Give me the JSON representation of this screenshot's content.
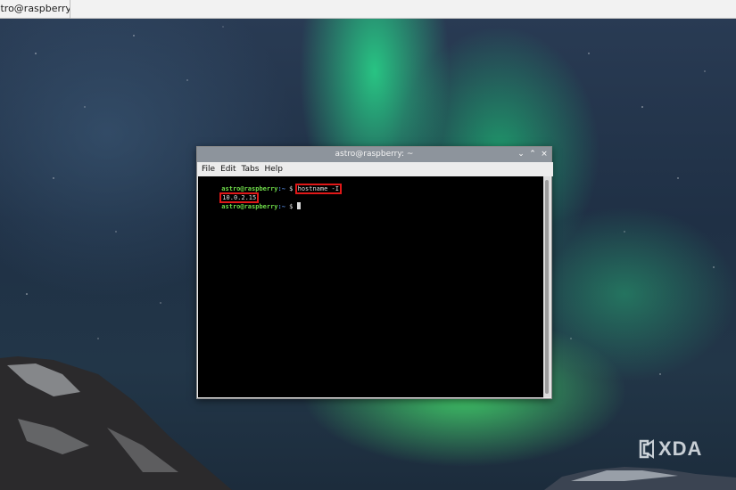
{
  "window": {
    "title": "astro@raspberry: ~"
  },
  "terminal": {
    "title": "astro@raspberry: ~",
    "menu": [
      "File",
      "Edit",
      "Tabs",
      "Help"
    ],
    "prompt_user": "astro@raspberry",
    "prompt_path": ":~",
    "prompt_symbol": " $ ",
    "command": "hostname -I",
    "output": "10.0.2.15",
    "controls": {
      "minimize": "⌄",
      "maximize": "⌃",
      "close": "×"
    }
  },
  "watermark": {
    "text": "XDA"
  },
  "colors": {
    "highlight": "#e01818",
    "prompt_user": "#6fdc4a",
    "prompt_path": "#5a8fe6"
  }
}
